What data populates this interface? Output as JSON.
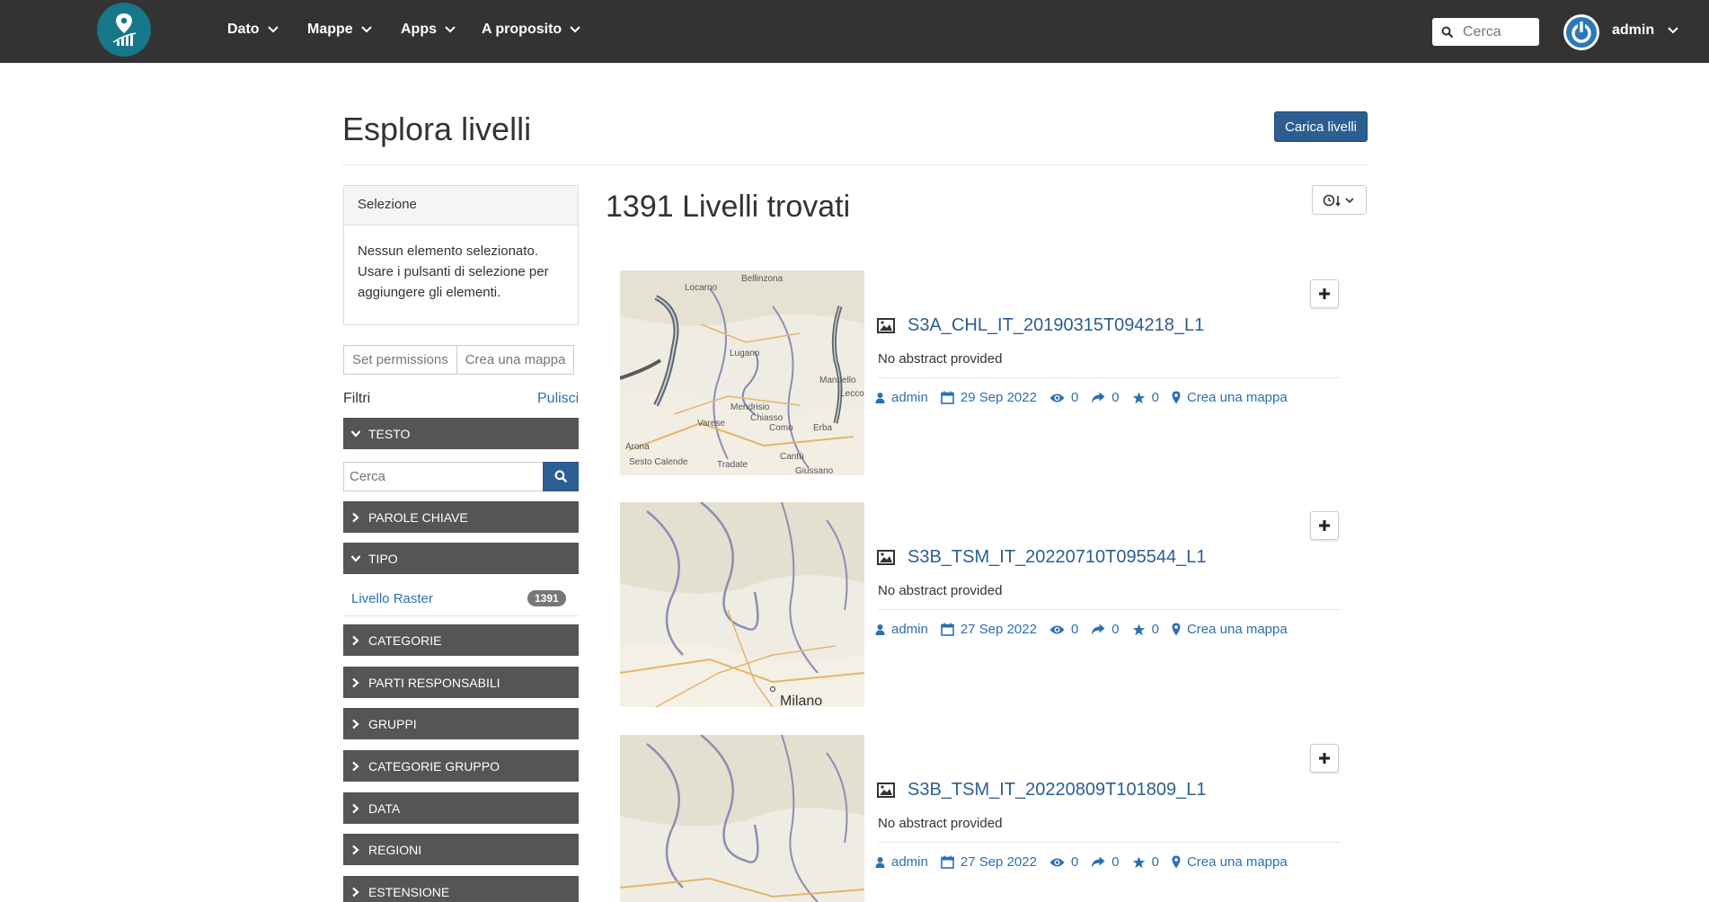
{
  "nav": {
    "menu": [
      "Dato",
      "Mappe",
      "Apps",
      "A proposito"
    ],
    "search_placeholder": "Cerca",
    "user": "admin"
  },
  "page": {
    "title": "Esplora livelli",
    "upload_button": "Carica livelli"
  },
  "sidebar": {
    "selection_title": "Selezione",
    "selection_text": "Nessun elemento selezionato. Usare i pulsanti di selezione per aggiungere gli elementi.",
    "set_permissions": "Set permissions",
    "create_map": "Crea una mappa",
    "filters_label": "Filtri",
    "clear_label": "Pulisci",
    "text_facet": "TESTO",
    "text_search_placeholder": "Cerca",
    "keywords_facet": "PAROLE CHIAVE",
    "type_facet": "TIPO",
    "type_option": {
      "label": "Livello Raster",
      "count": "1391"
    },
    "categories_facet": "CATEGORIE",
    "owners_facet": "PARTI RESPONSABILI",
    "groups_facet": "GRUPPI",
    "group_categories_facet": "CATEGORIE GRUPPO",
    "date_facet": "DATA",
    "regions_facet": "REGIONI",
    "extent_facet": "ESTENSIONE"
  },
  "results": {
    "count_label": "1391 Livelli trovati",
    "items": [
      {
        "title": "S3A_CHL_IT_20190315T094218_L1",
        "abstract": "No abstract provided",
        "owner": "admin",
        "date": "29 Sep 2022",
        "views": "0",
        "shares": "0",
        "rating": "0",
        "create_map": "Crea una mappa"
      },
      {
        "title": "S3B_TSM_IT_20220710T095544_L1",
        "abstract": "No abstract provided",
        "owner": "admin",
        "date": "27 Sep 2022",
        "views": "0",
        "shares": "0",
        "rating": "0",
        "create_map": "Crea una mappa"
      },
      {
        "title": "S3B_TSM_IT_20220809T101809_L1",
        "abstract": "No abstract provided",
        "owner": "admin",
        "date": "27 Sep 2022",
        "views": "0",
        "shares": "0",
        "rating": "0",
        "create_map": "Crea una mappa"
      }
    ]
  },
  "map_labels": {
    "map1": [
      "Bellinzona",
      "Locarno",
      "Lugano",
      "Mendrisio",
      "Chiasso",
      "Varese",
      "Como",
      "Erba",
      "Lecco",
      "Mandello",
      "Arona",
      "Sesto Calende",
      "Tradate",
      "Cantù",
      "Giussano"
    ],
    "map2": [
      "Milano"
    ]
  },
  "colors": {
    "navbar": "#333333",
    "primary": "#2c5e92",
    "link": "#2c6fb2",
    "facet_bg": "#555555",
    "logo": "#17778a"
  },
  "icons": [
    "map-pin-logo-icon",
    "chevron-down-icon",
    "search-icon",
    "power-icon",
    "chevron-right-icon",
    "image-icon",
    "user-icon",
    "calendar-icon",
    "eye-icon",
    "share-icon",
    "star-icon",
    "map-marker-icon",
    "plus-icon",
    "clock-sort-icon"
  ]
}
